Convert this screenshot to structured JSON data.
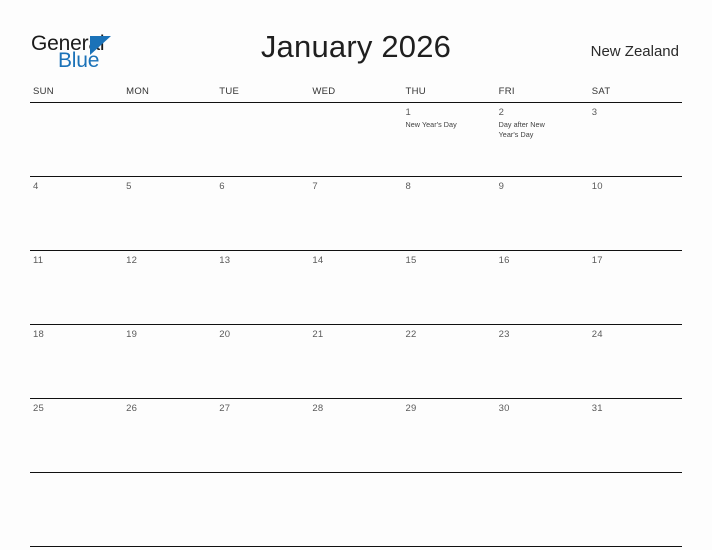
{
  "logo": {
    "text_top": "General",
    "text_bottom": "Blue",
    "triangle_color": "#1b72b8",
    "top_color": "#1a1a1a"
  },
  "header": {
    "title": "January 2026",
    "region": "New Zealand"
  },
  "calendar": {
    "weekdays": [
      "SUN",
      "MON",
      "TUE",
      "WED",
      "THU",
      "FRI",
      "SAT"
    ],
    "weeks": [
      [
        {
          "day": "",
          "event": ""
        },
        {
          "day": "",
          "event": ""
        },
        {
          "day": "",
          "event": ""
        },
        {
          "day": "",
          "event": ""
        },
        {
          "day": "1",
          "event": "New Year's Day"
        },
        {
          "day": "2",
          "event": "Day after New Year's Day"
        },
        {
          "day": "3",
          "event": ""
        }
      ],
      [
        {
          "day": "4",
          "event": ""
        },
        {
          "day": "5",
          "event": ""
        },
        {
          "day": "6",
          "event": ""
        },
        {
          "day": "7",
          "event": ""
        },
        {
          "day": "8",
          "event": ""
        },
        {
          "day": "9",
          "event": ""
        },
        {
          "day": "10",
          "event": ""
        }
      ],
      [
        {
          "day": "11",
          "event": ""
        },
        {
          "day": "12",
          "event": ""
        },
        {
          "day": "13",
          "event": ""
        },
        {
          "day": "14",
          "event": ""
        },
        {
          "day": "15",
          "event": ""
        },
        {
          "day": "16",
          "event": ""
        },
        {
          "day": "17",
          "event": ""
        }
      ],
      [
        {
          "day": "18",
          "event": ""
        },
        {
          "day": "19",
          "event": ""
        },
        {
          "day": "20",
          "event": ""
        },
        {
          "day": "21",
          "event": ""
        },
        {
          "day": "22",
          "event": ""
        },
        {
          "day": "23",
          "event": ""
        },
        {
          "day": "24",
          "event": ""
        }
      ],
      [
        {
          "day": "25",
          "event": ""
        },
        {
          "day": "26",
          "event": ""
        },
        {
          "day": "27",
          "event": ""
        },
        {
          "day": "28",
          "event": ""
        },
        {
          "day": "29",
          "event": ""
        },
        {
          "day": "30",
          "event": ""
        },
        {
          "day": "31",
          "event": ""
        }
      ],
      [
        {
          "day": "",
          "event": ""
        },
        {
          "day": "",
          "event": ""
        },
        {
          "day": "",
          "event": ""
        },
        {
          "day": "",
          "event": ""
        },
        {
          "day": "",
          "event": ""
        },
        {
          "day": "",
          "event": ""
        },
        {
          "day": "",
          "event": ""
        }
      ]
    ]
  },
  "colors": {
    "background": "#fdfdfd",
    "grid_line": "#111111",
    "day_number": "#5a5a5a",
    "event_text": "#404040",
    "brand_blue": "#1b72b8"
  }
}
